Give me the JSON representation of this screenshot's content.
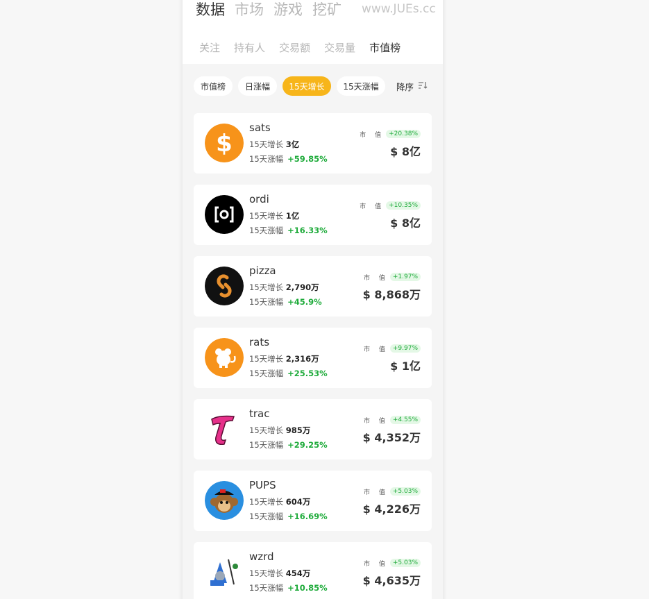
{
  "header": {
    "main_tabs": [
      "数据",
      "市场",
      "游戏",
      "挖矿"
    ],
    "active_main_tab": 0,
    "watermark": "www.JUEs.cc"
  },
  "sub_tabs": [
    "关注",
    "持有人",
    "交易额",
    "交易量",
    "市值榜"
  ],
  "active_sub_tab": 4,
  "filters": {
    "chips": [
      "市值榜",
      "日涨幅",
      "15天增长",
      "15天涨幅"
    ],
    "active_chip": 2,
    "sort_label": "降序",
    "sort_icon": "sort-descending-icon"
  },
  "labels": {
    "growth_label": "15天增长",
    "rise_label": "15天涨幅",
    "cap_label": "市 值"
  },
  "colors": {
    "accent": "#f7b51a",
    "positive": "#1fab3b",
    "positive_bg": "#e4f8e6"
  },
  "tokens": [
    {
      "name": "sats",
      "growth_15d": "3亿",
      "rise_15d": "+59.85%",
      "cap_change": "+20.38%",
      "market_cap": "$ 8亿",
      "icon": "dollar-coin-icon"
    },
    {
      "name": "ordi",
      "growth_15d": "1亿",
      "rise_15d": "+16.33%",
      "cap_change": "+10.35%",
      "market_cap": "$ 8亿",
      "icon": "ordi-logo-icon"
    },
    {
      "name": "pizza",
      "growth_15d": "2,790万",
      "rise_15d": "+45.9%",
      "cap_change": "+1.97%",
      "market_cap": "$ 8,868万",
      "icon": "pizza-logo-icon"
    },
    {
      "name": "rats",
      "growth_15d": "2,316万",
      "rise_15d": "+25.53%",
      "cap_change": "+9.97%",
      "market_cap": "$ 1亿",
      "icon": "rat-icon"
    },
    {
      "name": "trac",
      "growth_15d": "985万",
      "rise_15d": "+29.25%",
      "cap_change": "+4.55%",
      "market_cap": "$ 4,352万",
      "icon": "trac-logo-icon"
    },
    {
      "name": "PUPS",
      "growth_15d": "604万",
      "rise_15d": "+16.69%",
      "cap_change": "+5.03%",
      "market_cap": "$ 4,226万",
      "icon": "monkey-icon"
    },
    {
      "name": "wzrd",
      "growth_15d": "454万",
      "rise_15d": "+10.85%",
      "cap_change": "+5.03%",
      "market_cap": "$ 4,635万",
      "icon": "wizard-icon"
    }
  ]
}
